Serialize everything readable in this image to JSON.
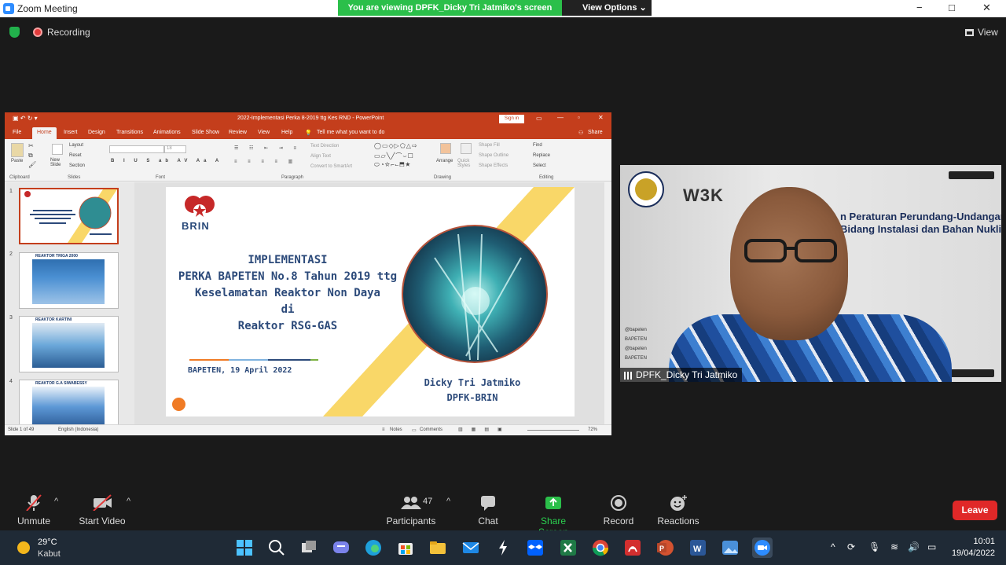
{
  "zoom": {
    "window_title": "Zoom Meeting",
    "banner": "You are viewing DPFK_Dicky Tri Jatmiko's screen",
    "view_options": "View Options",
    "recording": "Recording",
    "view": "View",
    "win_min": "−",
    "win_max": "□",
    "win_close": "✕"
  },
  "ppt": {
    "title": "2022-Implementasi Perka 8-2019 ttg Kes RND  -  PowerPoint",
    "signin": "Sign in",
    "tabs": [
      "File",
      "Home",
      "Insert",
      "Design",
      "Transitions",
      "Animations",
      "Slide Show",
      "Review",
      "View",
      "Help"
    ],
    "tell_me": "Tell me what you want to do",
    "share": "Share",
    "ribbon": {
      "paste": "Paste",
      "clipboard": "Clipboard",
      "new_slide": "New Slide",
      "layout": "Layout",
      "reset": "Reset",
      "section": "Section",
      "slides": "Slides",
      "font": "Font",
      "font_size": "18",
      "paragraph": "Paragraph",
      "text_direction": "Text Direction",
      "align_text": "Align Text",
      "convert_smartart": "Convert to SmartArt",
      "arrange": "Arrange",
      "quick_styles": "Quick Styles",
      "shape_fill": "Shape Fill",
      "shape_outline": "Shape Outline",
      "shape_effects": "Shape Effects",
      "drawing": "Drawing",
      "find": "Find",
      "replace": "Replace",
      "select": "Select",
      "editing": "Editing"
    },
    "thumbnails": [
      {
        "num": "1",
        "caption": ""
      },
      {
        "num": "2",
        "caption": "REAKTOR TRIGA 2000"
      },
      {
        "num": "3",
        "caption": "REAKTOR KARTINI"
      },
      {
        "num": "4",
        "caption": "REAKTOR G.A SIWABESSY"
      }
    ],
    "slide": {
      "logo_text": "BRIN",
      "line1": "IMPLEMENTASI",
      "line2": "PERKA BAPETEN No.8 Tahun 2019 ttg",
      "line3": "Keselamatan Reaktor Non Daya",
      "line4": "di",
      "line5": "Reaktor RSG-GAS",
      "date": "BAPETEN, 19 April 2022",
      "author1": "Dicky Tri Jatmiko",
      "author2": "DPFK-BRIN"
    },
    "status": {
      "slide_of": "Slide 1 of 49",
      "language": "English (Indonesia)",
      "notes": "Notes",
      "comments": "Comments",
      "zoom": "72%"
    }
  },
  "camera": {
    "line1": "n Peraturan Perundang-Undangan",
    "line2": "Bidang Instalasi dan Bahan Nuklir",
    "logo_text": "W3K",
    "social": [
      "@bapeten",
      "BAPETEN",
      "@bapeten",
      "BAPETEN"
    ],
    "participant": "DPFK_Dicky Tri Jatmiko"
  },
  "controls": {
    "unmute": "Unmute",
    "start_video": "Start Video",
    "participants": "Participants",
    "participant_count": "47",
    "chat": "Chat",
    "share_screen": "Share Screen",
    "record": "Record",
    "reactions": "Reactions",
    "leave": "Leave"
  },
  "taskbar": {
    "temp": "29°C",
    "weather": "Kabut",
    "time": "10:01",
    "date": "19/04/2022"
  },
  "colors": {
    "ppt_accent": "#c43e1c",
    "share_green": "#2bbf4a",
    "leave_red": "#e02828",
    "slide_navy": "#2c4a7a",
    "slide_yellow": "#f9d768",
    "slide_orange": "#f07b25"
  }
}
